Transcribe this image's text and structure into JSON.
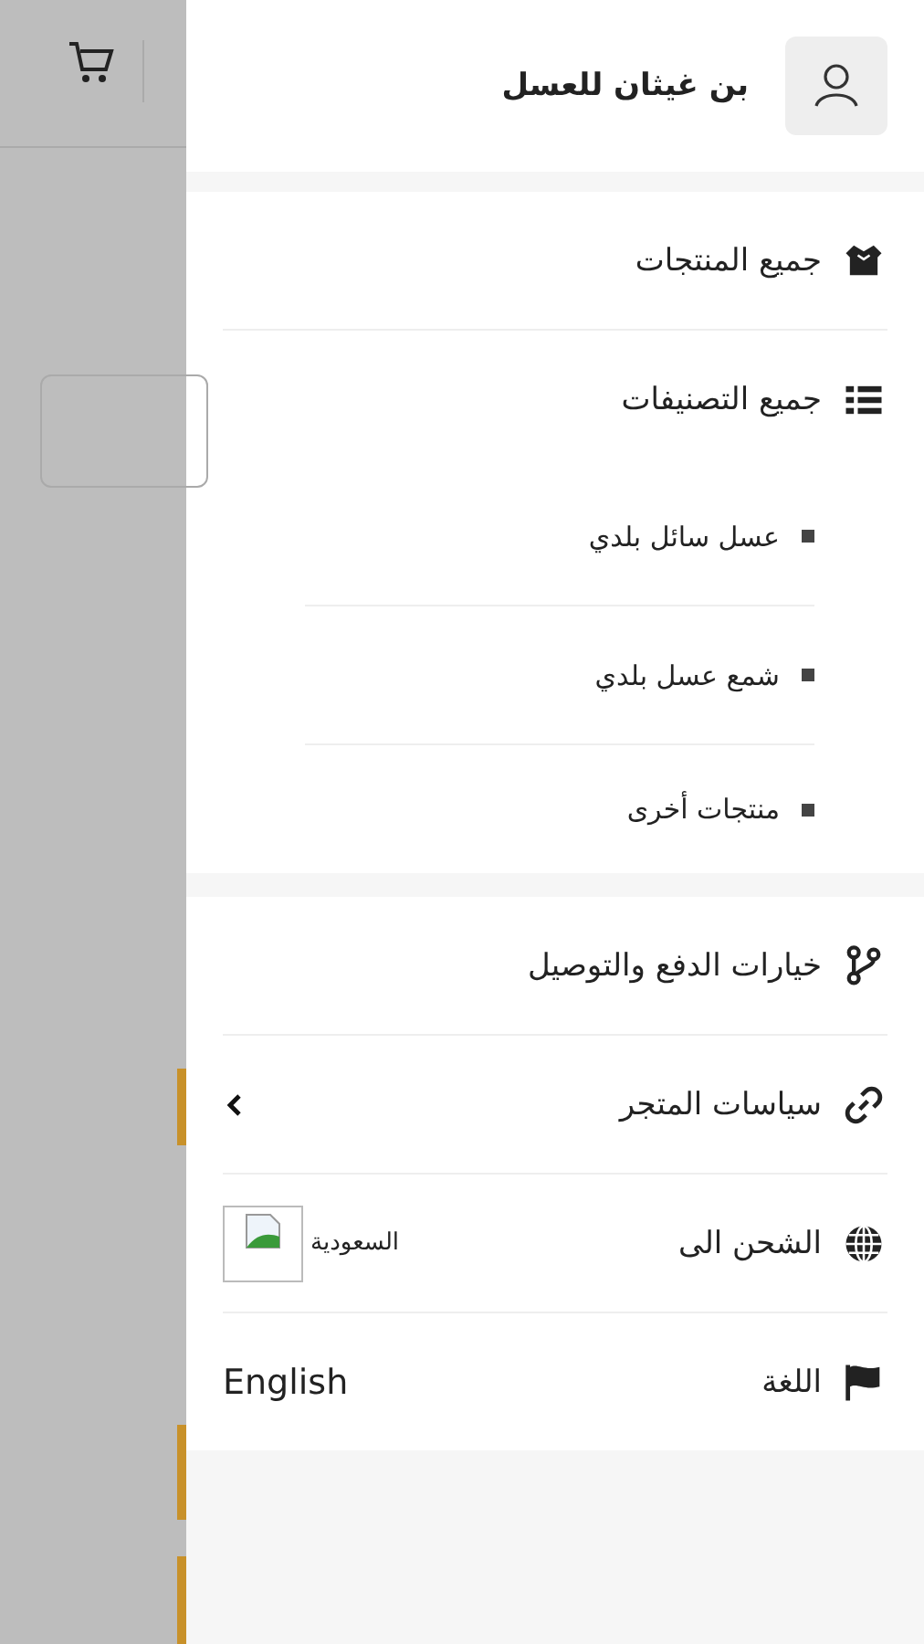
{
  "store": {
    "name": "بن غيثان للعسل"
  },
  "menu": [
    {
      "label": "جميع المنتجات"
    },
    {
      "label": "جميع التصنيفات",
      "children": [
        {
          "label": "عسل سائل بلدي"
        },
        {
          "label": "شمع عسل بلدي"
        },
        {
          "label": "منتجات أخرى"
        }
      ]
    }
  ],
  "links": [
    {
      "label": "خيارات الدفع والتوصيل",
      "kind": "link"
    },
    {
      "label": "سياسات المتجر",
      "kind": "expand",
      "expanded": false
    },
    {
      "label": "الشحن الى",
      "kind": "country",
      "value": "السعودية"
    },
    {
      "label": "اللغة",
      "kind": "language",
      "value": "English"
    }
  ]
}
